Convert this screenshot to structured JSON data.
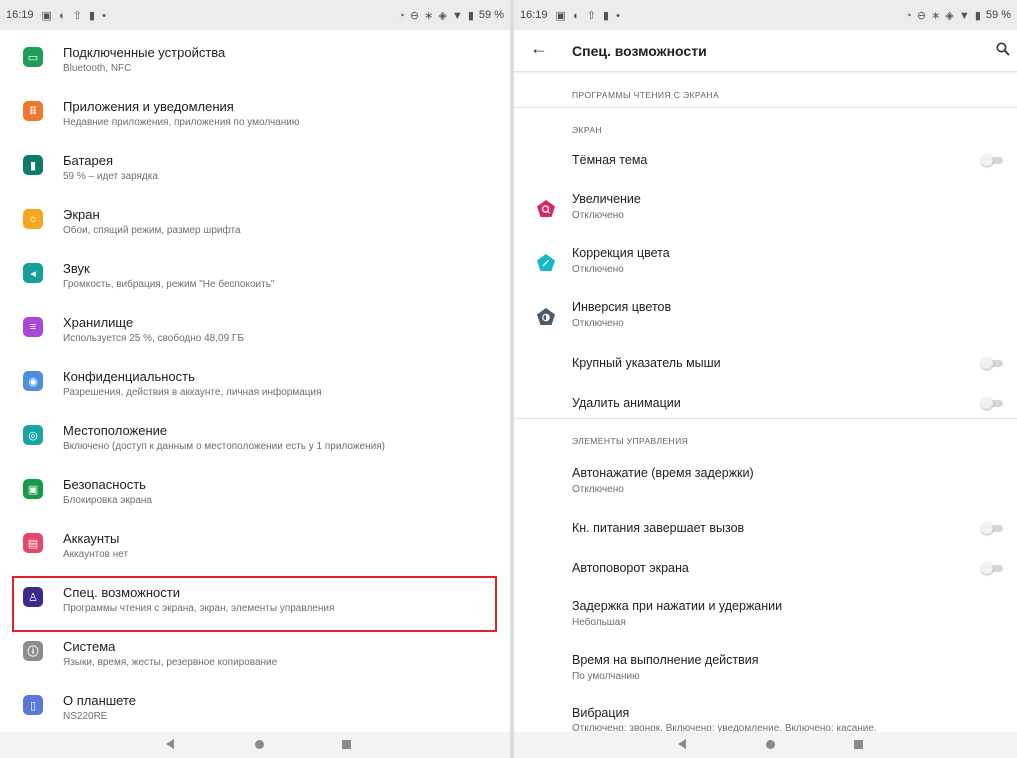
{
  "left": {
    "status": {
      "time": "16:19",
      "battery": "59 %"
    },
    "items": [
      {
        "title": "Подключенные устройства",
        "subtitle": "Bluetooth, NFC",
        "icon": "connected-devices-icon",
        "color": "#1e9e5a",
        "glyph": "▭"
      },
      {
        "title": "Приложения и уведомления",
        "subtitle": "Недавние приложения, приложения по умолчанию",
        "icon": "apps-icon",
        "color": "#f0782c",
        "glyph": "⠿"
      },
      {
        "title": "Батарея",
        "subtitle": "59 % – идет зарядка",
        "icon": "battery-icon",
        "color": "#0e7a6a",
        "glyph": "▮"
      },
      {
        "title": "Экран",
        "subtitle": "Обои, спящий режим, размер шрифта",
        "icon": "display-icon",
        "color": "#f5a623",
        "glyph": "☼"
      },
      {
        "title": "Звук",
        "subtitle": "Громкость, вибрация, режим \"Не беспокоить\"",
        "icon": "sound-icon",
        "color": "#18a098",
        "glyph": "◂"
      },
      {
        "title": "Хранилище",
        "subtitle": "Используется 25 %, свободно 48,09 ГБ",
        "icon": "storage-icon",
        "color": "#a748d6",
        "glyph": "≡"
      },
      {
        "title": "Конфиденциальность",
        "subtitle": "Разрешения, действия в аккаунте, личная информация",
        "icon": "privacy-icon",
        "color": "#4a8fe0",
        "glyph": "◉"
      },
      {
        "title": "Местоположение",
        "subtitle": "Включено (доступ к данным о местоположении есть у 1 приложения)",
        "icon": "location-icon",
        "color": "#1aa5a5",
        "glyph": "◎"
      },
      {
        "title": "Безопасность",
        "subtitle": "Блокировка экрана",
        "icon": "security-icon",
        "color": "#159a48",
        "glyph": "▣"
      },
      {
        "title": "Аккаунты",
        "subtitle": "Аккаунтов нет",
        "icon": "accounts-icon",
        "color": "#e8456a",
        "glyph": "▤"
      },
      {
        "title": "Спец. возможности",
        "subtitle": "Программы чтения с экрана, экран, элементы управления",
        "icon": "accessibility-icon",
        "color": "#3a2a8c",
        "glyph": "♙"
      },
      {
        "title": "Система",
        "subtitle": "Языки, время, жесты, резервное копирование",
        "icon": "system-icon",
        "color": "#8c8c8c",
        "glyph": "ⓘ"
      },
      {
        "title": "О планшете",
        "subtitle": "NS220RE",
        "icon": "about-tablet-icon",
        "color": "#5b78d8",
        "glyph": "▯"
      }
    ]
  },
  "right": {
    "status": {
      "time": "16:19",
      "battery": "59 %"
    },
    "title": "Спец. возможности",
    "sections": {
      "screen_readers": "ПРОГРАММЫ ЧТЕНИЯ С ЭКРАНА",
      "display": "ЭКРАН",
      "controls": "ЭЛЕМЕНТЫ УПРАВЛЕНИЯ"
    },
    "dark_theme": "Тёмная тема",
    "magnification": {
      "title": "Увеличение",
      "subtitle": "Отключено",
      "color": "#e0245e"
    },
    "color_correction": {
      "title": "Коррекция цвета",
      "subtitle": "Отключено",
      "color": "#18b6c9"
    },
    "color_inversion": {
      "title": "Инверсия цветов",
      "subtitle": "Отключено",
      "color": "#4d5b6a"
    },
    "large_pointer": "Крупный указатель мыши",
    "remove_animations": "Удалить анимации",
    "autoclick": {
      "title": "Автонажатие (время задержки)",
      "subtitle": "Отключено"
    },
    "power_ends_call": "Кн. питания завершает вызов",
    "auto_rotate": "Автоповорот экрана",
    "touch_hold_delay": {
      "title": "Задержка при нажатии и удержании",
      "subtitle": "Небольшая"
    },
    "action_time": {
      "title": "Время на выполнение действия",
      "subtitle": "По умолчанию"
    },
    "vibration": {
      "title": "Вибрация",
      "subtitle": "Отключено: звонок. Включено: уведомление. Включено: касание."
    }
  },
  "toggles_state": {
    "dark_theme": false,
    "large_pointer": false,
    "remove_animations": false,
    "power_ends_call": false,
    "auto_rotate": false
  }
}
